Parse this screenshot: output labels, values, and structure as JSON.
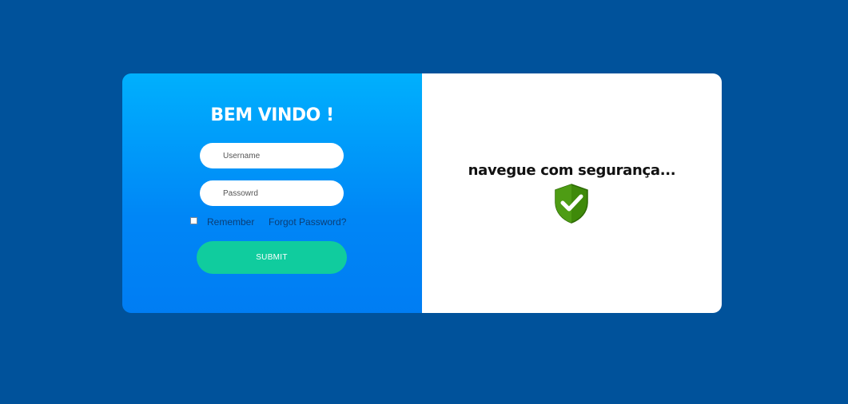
{
  "login": {
    "title": "BEM VINDO !",
    "username_placeholder": "Username",
    "password_placeholder": "Passowrd",
    "remember_label": "Remember",
    "remember_checked": false,
    "forgot_label": "Forgot Password?",
    "submit_label": "SUBMIT"
  },
  "promo": {
    "tagline": "navegue com segurança...",
    "icon": "shield-check-icon"
  },
  "colors": {
    "page_background": "#00529b",
    "panel_gradient_top": "#00b0fd",
    "panel_gradient_bottom": "#007df3",
    "submit_button": "#10cc9e",
    "shield": "#3f8a0a"
  }
}
